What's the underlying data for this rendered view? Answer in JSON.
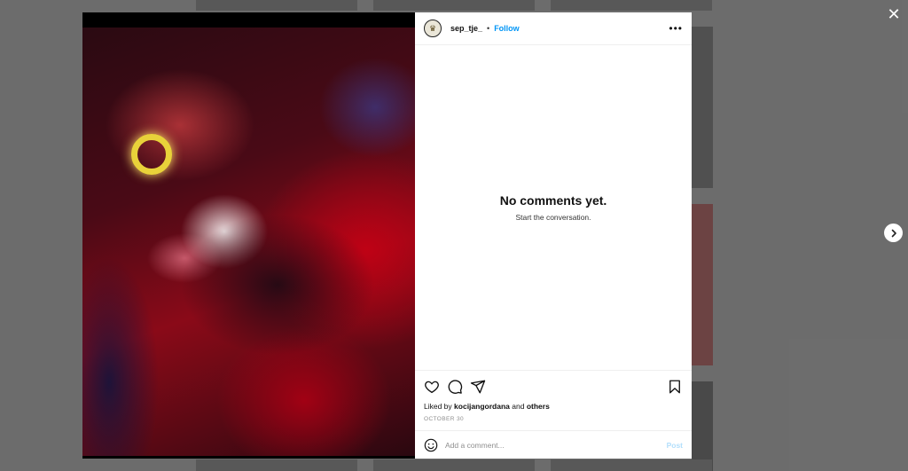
{
  "post": {
    "username": "sep_tje_",
    "separator": "•",
    "follow_label": "Follow",
    "more_label": "•••"
  },
  "comments": {
    "empty_title": "No comments yet.",
    "empty_subtitle": "Start the conversation."
  },
  "likes": {
    "prefix": "Liked by",
    "user": "kocijangordana",
    "middle": "and",
    "others": "others"
  },
  "date": "OCTOBER 30",
  "comment_box": {
    "placeholder": "Add a comment...",
    "post_label": "Post"
  },
  "icons": {
    "close": "close-icon",
    "next": "chevron-right-icon",
    "like": "heart-icon",
    "comment": "comment-icon",
    "share": "share-icon",
    "save": "bookmark-icon",
    "emoji": "emoji-icon"
  },
  "colors": {
    "link": "#0095f6",
    "post_disabled": "#b2dffc",
    "muted": "#8e8e8e"
  }
}
